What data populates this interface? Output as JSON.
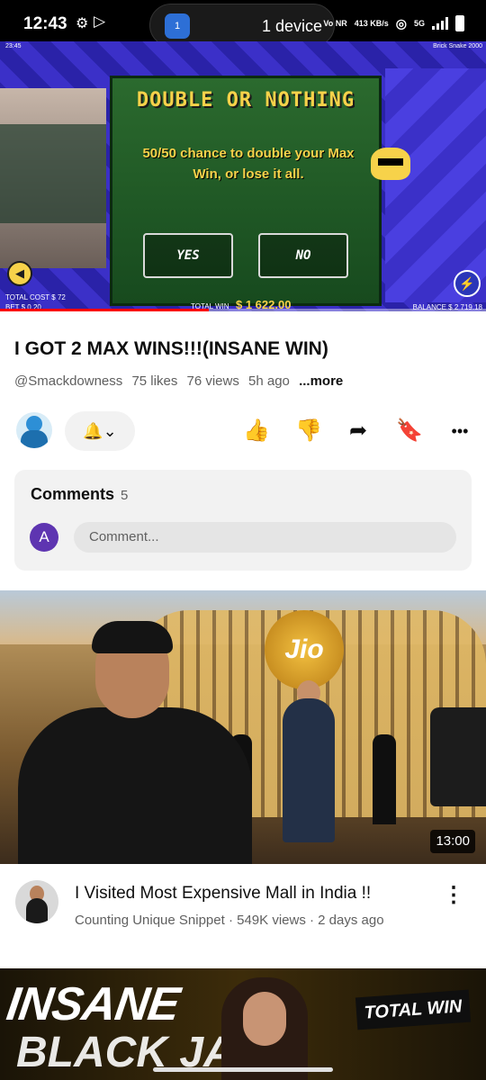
{
  "status_bar": {
    "time": "12:43",
    "cast_badge": "1",
    "device_label": "1 device",
    "network": "Vo NR",
    "speed": "413 KB/s",
    "signal": "5G"
  },
  "player": {
    "game_title": "DOUBLE OR NOTHING",
    "game_subtitle": "50/50 chance to double your Max Win, or lose it all.",
    "yes_label": "YES",
    "no_label": "NO",
    "overlay_time": "23:45",
    "overlay_game": "Brick Snake 2000",
    "total_cost": "TOTAL COST $ 72",
    "bet": "BET $ 0.20",
    "total_win_label": "TOTAL WIN",
    "total_win": "$ 1 622.00",
    "balance": "BALANCE $ 2 719.18",
    "progress": 0.43
  },
  "video": {
    "title": "I GOT 2 MAX WINS!!!(INSANE WIN)",
    "channel": "@Smackdowness",
    "likes": "75 likes",
    "views": "76 views",
    "age": "5h ago",
    "more": "...more"
  },
  "actions": {
    "bell": "🔔⌄",
    "like": "👍",
    "dislike": "👎",
    "share": "➦",
    "save": "🔖",
    "overflow": "•••"
  },
  "comments": {
    "title": "Comments",
    "count": "5",
    "avatar_letter": "A",
    "placeholder": "Comment..."
  },
  "recommended": {
    "thumb_logo": "Jio",
    "duration": "13:00",
    "title": "I Visited Most Expensive Mall in India !!",
    "meta": "Counting Unique Snippet · 549K views · 2 days ago",
    "menu": "⋮"
  },
  "next": {
    "insane": "INSANE",
    "blackjack": "BLACK JACK",
    "total_win": "TOTAL WIN"
  },
  "icons": {
    "gear": "gear-icon",
    "play_store": "play-store-icon",
    "sound": "volume-icon",
    "bolt": "bolt-icon"
  },
  "colors": {
    "accent_red": "#ff0000",
    "game_yellow": "#f7d24a",
    "comment_avatar": "#5e35b1"
  }
}
